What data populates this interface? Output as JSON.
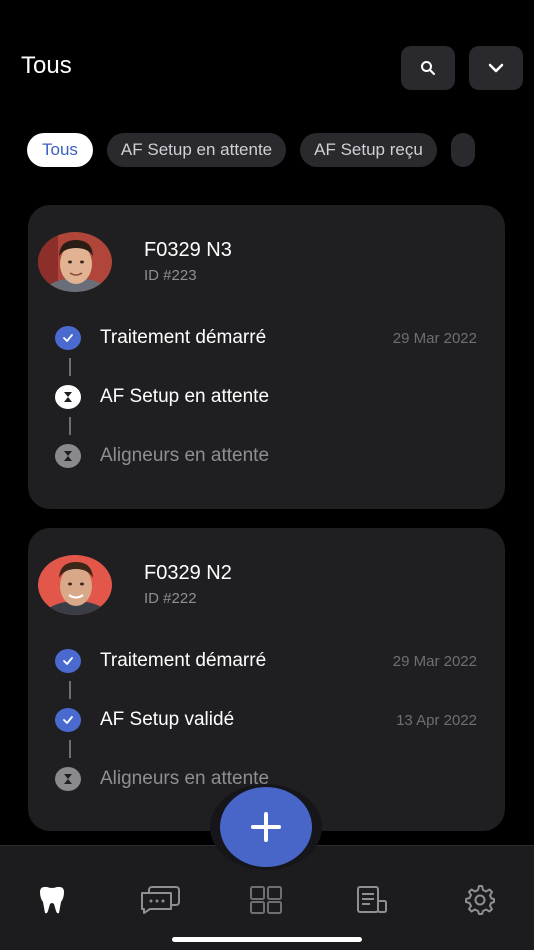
{
  "header": {
    "title": "Tous"
  },
  "filters": [
    {
      "label": "Tous",
      "active": true
    },
    {
      "label": "AF Setup en attente",
      "active": false
    },
    {
      "label": "AF Setup reçu",
      "active": false
    },
    {
      "label": "",
      "active": false
    }
  ],
  "patients": [
    {
      "name": "F0329 N3",
      "id": "ID #223",
      "steps": [
        {
          "label": "Traitement démarré",
          "date": "29 Mar 2022",
          "status": "done"
        },
        {
          "label": "AF Setup en attente",
          "date": "",
          "status": "waiting"
        },
        {
          "label": "Aligneurs en attente",
          "date": "",
          "status": "pending"
        }
      ]
    },
    {
      "name": "F0329 N2",
      "id": "ID #222",
      "steps": [
        {
          "label": "Traitement démarré",
          "date": "29 Mar 2022",
          "status": "done"
        },
        {
          "label": "AF Setup validé",
          "date": "13 Apr 2022",
          "status": "done"
        },
        {
          "label": "Aligneurs en attente",
          "date": "",
          "status": "pending"
        }
      ]
    }
  ],
  "tabs": [
    {
      "icon": "tooth-icon",
      "active": true
    },
    {
      "icon": "chat-icon",
      "active": false
    },
    {
      "icon": "dashboard-icon",
      "active": false
    },
    {
      "icon": "document-icon",
      "active": false
    },
    {
      "icon": "settings-icon",
      "active": false
    }
  ],
  "colors": {
    "accent": "#4866c8",
    "background": "#000000",
    "card": "#1f1f22"
  }
}
